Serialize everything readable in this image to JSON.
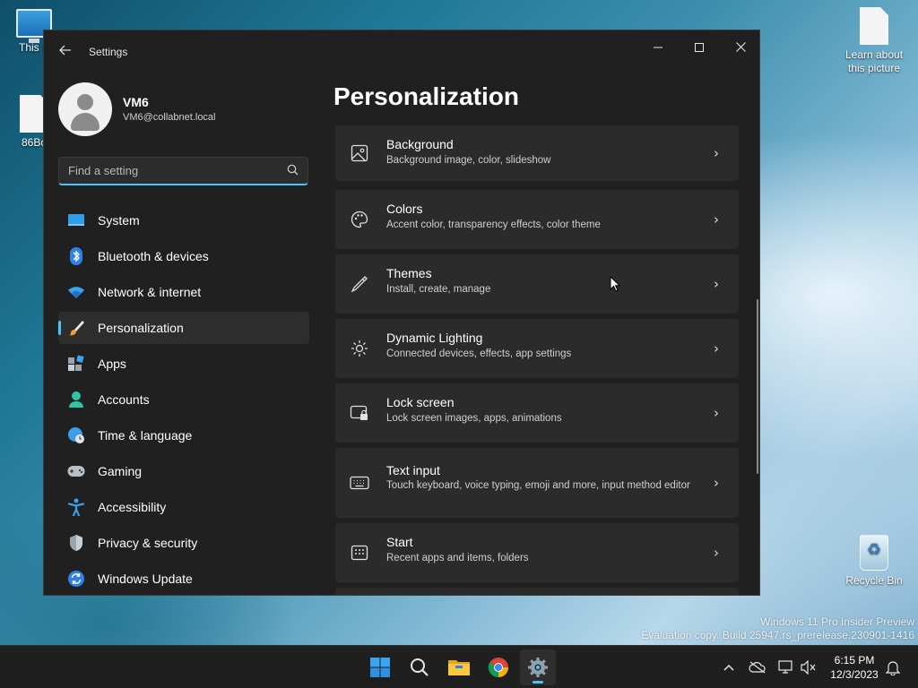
{
  "desktop": {
    "icons": [
      {
        "label": "This P"
      },
      {
        "label": "86Bo"
      },
      {
        "label": "Learn about this picture"
      },
      {
        "label": "Recycle Bin"
      }
    ],
    "watermark": {
      "line1": "Windows 11 Pro Insider Preview",
      "line2": "Evaluation copy. Build 25947.rs_prerelease.230901-1416"
    }
  },
  "window": {
    "title": "Settings",
    "back_icon": "back-arrow-icon",
    "controls": {
      "minimize": "—",
      "maximize": "☐",
      "close": "✕"
    }
  },
  "profile": {
    "name": "VM6",
    "email": "VM6@collabnet.local"
  },
  "search": {
    "placeholder": "Find a setting",
    "value": ""
  },
  "sidebar": {
    "items": [
      {
        "label": "System",
        "icon": "system-icon",
        "active": false
      },
      {
        "label": "Bluetooth & devices",
        "icon": "bluetooth-icon",
        "active": false
      },
      {
        "label": "Network & internet",
        "icon": "wifi-icon",
        "active": false
      },
      {
        "label": "Personalization",
        "icon": "brush-icon",
        "active": true
      },
      {
        "label": "Apps",
        "icon": "apps-icon",
        "active": false
      },
      {
        "label": "Accounts",
        "icon": "accounts-icon",
        "active": false
      },
      {
        "label": "Time & language",
        "icon": "globe-clock-icon",
        "active": false
      },
      {
        "label": "Gaming",
        "icon": "gamepad-icon",
        "active": false
      },
      {
        "label": "Accessibility",
        "icon": "accessibility-icon",
        "active": false
      },
      {
        "label": "Privacy & security",
        "icon": "shield-icon",
        "active": false
      },
      {
        "label": "Windows Update",
        "icon": "update-icon",
        "active": false
      }
    ]
  },
  "main": {
    "title": "Personalization",
    "cards": [
      {
        "title": "Background",
        "subtitle": "Background image, color, slideshow",
        "icon": "image-icon"
      },
      {
        "title": "Colors",
        "subtitle": "Accent color, transparency effects, color theme",
        "icon": "palette-icon"
      },
      {
        "title": "Themes",
        "subtitle": "Install, create, manage",
        "icon": "pen-icon"
      },
      {
        "title": "Dynamic Lighting",
        "subtitle": "Connected devices, effects, app settings",
        "icon": "lighting-icon"
      },
      {
        "title": "Lock screen",
        "subtitle": "Lock screen images, apps, animations",
        "icon": "lock-screen-icon"
      },
      {
        "title": "Text input",
        "subtitle": "Touch keyboard, voice typing, emoji and more, input method editor",
        "icon": "keyboard-icon"
      },
      {
        "title": "Start",
        "subtitle": "Recent apps and items, folders",
        "icon": "start-menu-icon"
      }
    ]
  },
  "taskbar": {
    "apps": [
      {
        "name": "start-button",
        "icon": "windows-logo-icon"
      },
      {
        "name": "search-button",
        "icon": "search-icon"
      },
      {
        "name": "file-explorer-button",
        "icon": "folder-icon"
      },
      {
        "name": "chrome-button",
        "icon": "chrome-icon"
      },
      {
        "name": "settings-button",
        "icon": "gear-icon",
        "active": true
      }
    ],
    "tray": {
      "time": "6:15 PM",
      "date": "12/3/2023"
    },
    "accent": "#4cc2ff"
  }
}
